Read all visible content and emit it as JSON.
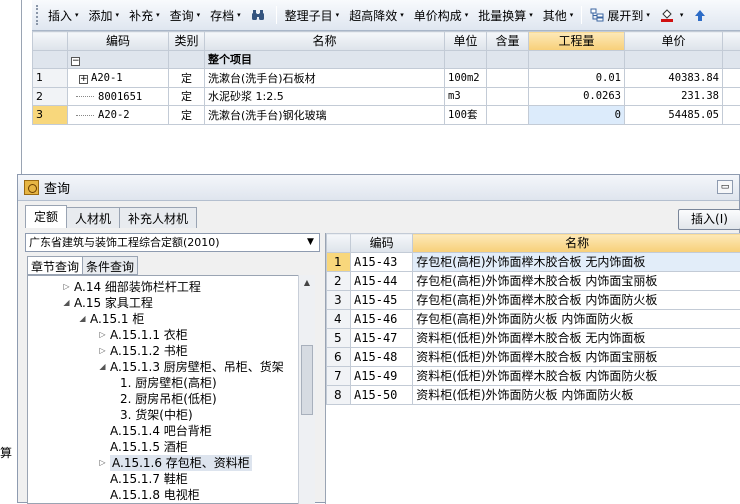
{
  "toolbar": {
    "items": [
      {
        "label": "插入",
        "dd": "▾"
      },
      {
        "label": "添加",
        "dd": "▾"
      },
      {
        "label": "补充",
        "dd": "▾"
      },
      {
        "label": "查询",
        "dd": "▾"
      },
      {
        "label": "存档",
        "dd": "▾"
      },
      {
        "label": "整理子目",
        "dd": "▾"
      },
      {
        "label": "超高降效",
        "dd": "▾"
      },
      {
        "label": "单价构成",
        "dd": "▾"
      },
      {
        "label": "批量换算",
        "dd": "▾"
      },
      {
        "label": "其他",
        "dd": "▾"
      },
      {
        "label": "展开到",
        "dd": "▾"
      }
    ]
  },
  "main_grid": {
    "columns": [
      "编码",
      "类别",
      "名称",
      "单位",
      "含量",
      "工程量",
      "单价"
    ],
    "group_label": "整个项目",
    "rows": [
      {
        "n": "1",
        "code": "A20-1",
        "cat": "定",
        "name": "洗漱台(洗手台)石板材",
        "unit": "100m2",
        "content": "",
        "qty": "0.01",
        "price": "40383.84"
      },
      {
        "n": "2",
        "code": "8001651",
        "cat": "定",
        "name": "水泥砂浆 1:2.5",
        "unit": "m3",
        "content": "",
        "qty": "0.0263",
        "price": "231.38"
      },
      {
        "n": "3",
        "code": "A20-2",
        "cat": "定",
        "name": "洗漱台(洗手台)钢化玻璃",
        "unit": "100套",
        "content": "",
        "qty": "0",
        "price": "54485.05"
      }
    ]
  },
  "dialog": {
    "title": "查询",
    "tabs": [
      "定额",
      "人材机",
      "补充人材机"
    ],
    "insert_label": "插入(I)",
    "library": "广东省建筑与装饰工程综合定额(2010)",
    "subtabs": [
      "章节查询",
      "条件查询"
    ],
    "tree": [
      {
        "label": "A.14 细部装饰栏杆工程",
        "exp": "▷"
      },
      {
        "label": "A.15 家具工程",
        "exp": "◢"
      },
      {
        "label": "A.15.1 柜",
        "exp": "◢"
      },
      {
        "label": "A.15.1.1 衣柜",
        "exp": "▷"
      },
      {
        "label": "A.15.1.2 书柜",
        "exp": "▷"
      },
      {
        "label": "A.15.1.3 厨房壁柜、吊柜、货架",
        "exp": "◢"
      },
      {
        "label": "1. 厨房壁柜(高柜)",
        "exp": ""
      },
      {
        "label": "2. 厨房吊柜(低柜)",
        "exp": ""
      },
      {
        "label": "3. 货架(中柜)",
        "exp": ""
      },
      {
        "label": "A.15.1.4 吧台背柜",
        "exp": ""
      },
      {
        "label": "A.15.1.5 酒柜",
        "exp": ""
      },
      {
        "label": "A.15.1.6 存包柜、资料柜",
        "exp": "▷"
      },
      {
        "label": "A.15.1.7 鞋柜",
        "exp": ""
      },
      {
        "label": "A.15.1.8 电视柜",
        "exp": ""
      }
    ],
    "result_columns": [
      "编码",
      "名称"
    ],
    "results": [
      {
        "n": "1",
        "code": "A15-43",
        "name": "存包柜(高柜)外饰面榉木胶合板 无内饰面板"
      },
      {
        "n": "2",
        "code": "A15-44",
        "name": "存包柜(高柜)外饰面榉木胶合板 内饰面宝丽板"
      },
      {
        "n": "3",
        "code": "A15-45",
        "name": "存包柜(高柜)外饰面榉木胶合板 内饰面防火板"
      },
      {
        "n": "4",
        "code": "A15-46",
        "name": "存包柜(高柜)外饰面防火板 内饰面防火板"
      },
      {
        "n": "5",
        "code": "A15-47",
        "name": "资料柜(低柜)外饰面榉木胶合板 无内饰面板"
      },
      {
        "n": "6",
        "code": "A15-48",
        "name": "资料柜(低柜)外饰面榉木胶合板 内饰面宝丽板"
      },
      {
        "n": "7",
        "code": "A15-49",
        "name": "资料柜(低柜)外饰面榉木胶合板 内饰面防火板"
      },
      {
        "n": "8",
        "code": "A15-50",
        "name": "资料柜(低柜)外饰面防火板 内饰面防火板"
      }
    ]
  },
  "left_strip_char": "算"
}
